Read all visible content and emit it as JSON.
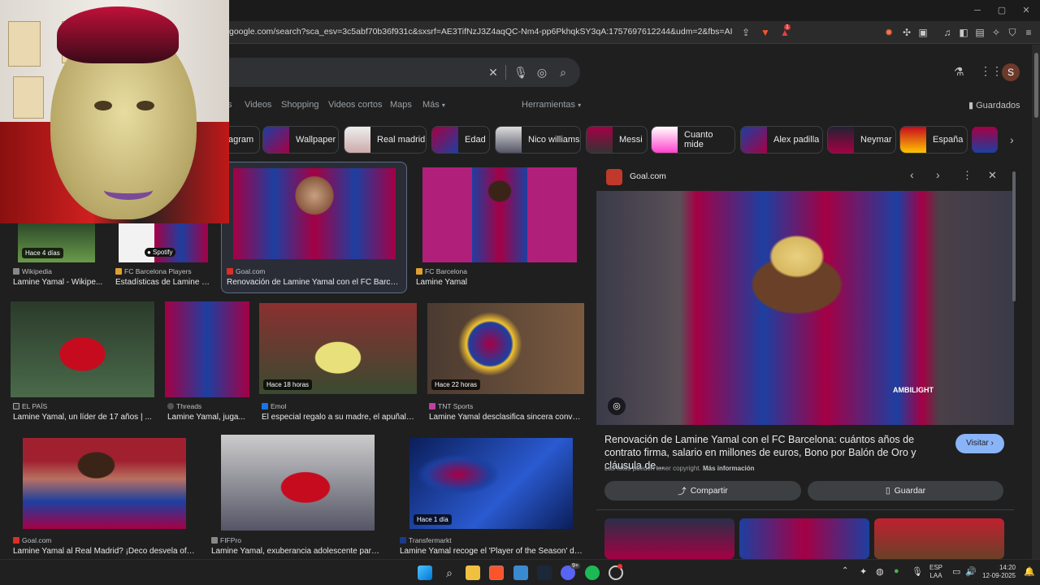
{
  "browser": {
    "url": "google.com/search?sca_esv=3c5abf70b36f931c&sxsrf=AE3TifNzJ3Z4aqQC-Nm4-pp6PkhqkSY3qA:1757697612244&udm=2&fbs=AIIjpHx4nJjfGojPV...",
    "shield_count": "1"
  },
  "header": {
    "avatar": "S",
    "nav": [
      "s",
      "Videos",
      "Shopping",
      "Videos cortos",
      "Maps",
      "Más",
      "Herramientas"
    ],
    "saved": "Guardados"
  },
  "chips": [
    "agram",
    "Wallpaper",
    "Real madrid",
    "Edad",
    "Nico williams",
    "Messi",
    "Cuanto mide",
    "Alex padilla",
    "Neymar",
    "España"
  ],
  "results": [
    {
      "source": "Wikipedia",
      "caption": "Lamine Yamal - Wikipe...",
      "badge": "Hace 4 días"
    },
    {
      "source": "FC Barcelona Players",
      "caption": "Estadísticas de Lamine Y..."
    },
    {
      "source": "Goal.com",
      "caption": "Renovación de Lamine Yamal con el FC Barcel..."
    },
    {
      "source": "FC Barcelona",
      "caption": "Lamine Yamal"
    },
    {
      "source": "EL PAÍS",
      "caption": "Lamine Yamal, un líder de 17 años | ..."
    },
    {
      "source": "Threads",
      "caption": "Lamine Yamal, juga..."
    },
    {
      "source": "Emol",
      "caption": "El especial regalo a su madre, el apuñala...",
      "badge": "Hace 18 horas"
    },
    {
      "source": "TNT Sports",
      "caption": "Lamine Yamal desclasifica sincera conver...",
      "badge": "Hace 22 horas"
    },
    {
      "source": "Goal.com",
      "caption": "Lamine Yamal al Real Madrid? ¡Deco desvela ofer..."
    },
    {
      "source": "FIFPro",
      "caption": "Lamine Yamal, exuberancia adolescente para a..."
    },
    {
      "source": "Transfermarkt",
      "caption": "Lamine Yamal recoge el 'Player of the Season' de ...",
      "badge": "Hace 1 día"
    }
  ],
  "panel": {
    "source": "Goal.com",
    "title": "Renovación de Lamine Yamal con el FC Barcelona: cuántos años de contrato firma, salario en millones de euros, Bono por Balón de Oro y cláusula de...",
    "visit": "Visitar",
    "copyright": "Las fotos pueden tener copyright.",
    "more_info": "Más información",
    "share": "Compartir",
    "save": "Guardar",
    "jersey_text": "AMBILIGHT"
  },
  "taskbar": {
    "lang": "ESP",
    "layout": "LAA",
    "time": "14:20",
    "date": "12-09-2025",
    "notify": "9+"
  },
  "colors": {
    "barca_blue": "#1d3fa0",
    "barca_red": "#a50044",
    "accent_blue": "#8ab4f8"
  }
}
